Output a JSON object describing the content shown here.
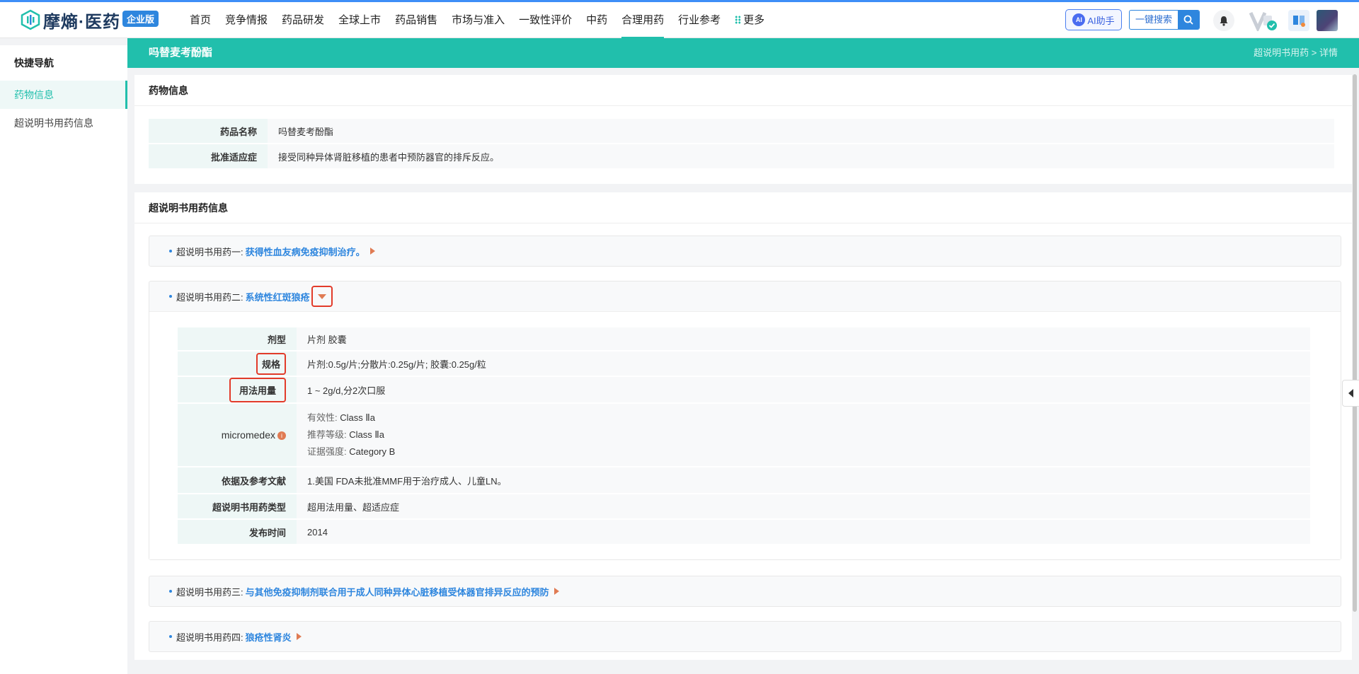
{
  "brand": {
    "name": "摩熵·医药",
    "badge": "企业版"
  },
  "nav": [
    {
      "label": "首页"
    },
    {
      "label": "竞争情报"
    },
    {
      "label": "药品研发"
    },
    {
      "label": "全球上市"
    },
    {
      "label": "药品销售"
    },
    {
      "label": "市场与准入"
    },
    {
      "label": "一致性评价"
    },
    {
      "label": "中药"
    },
    {
      "label": "合理用药",
      "active": true
    },
    {
      "label": "行业参考"
    },
    {
      "label": "更多"
    }
  ],
  "toolbar": {
    "ai_label": "AI助手",
    "ai_icon": "AI",
    "search_label": "一键搜索"
  },
  "sidebar": {
    "title": "快捷导航",
    "items": [
      {
        "label": "药物信息",
        "active": true
      },
      {
        "label": "超说明书用药信息"
      }
    ]
  },
  "header": {
    "title": "吗替麦考酚酯",
    "breadcrumb": "超说明书用药 > 详情"
  },
  "drug_info": {
    "title": "药物信息",
    "rows": [
      {
        "key": "药品名称",
        "value": "吗替麦考酚酯"
      },
      {
        "key": "批准适应症",
        "value": "接受同种异体肾脏移植的患者中预防器官的排斥反应。"
      }
    ]
  },
  "offlabel": {
    "title": "超说明书用药信息",
    "items": [
      {
        "label": "超说明书用药一:",
        "link": "获得性血友病免疫抑制治疗。"
      },
      {
        "label": "超说明书用药二:",
        "link": "系统性红斑狼疮"
      },
      {
        "label": "超说明书用药三:",
        "link": "与其他免疫抑制剂联合用于成人同种异体心脏移植受体器官排异反应的预防"
      },
      {
        "label": "超说明书用药四:",
        "link": "狼疮性肾炎"
      }
    ],
    "detail": {
      "dosage_form": {
        "key": "剂型",
        "value": "片剂 胶囊"
      },
      "spec": {
        "key": "规格",
        "value": "片剂:0.5g/片;分散片:0.25g/片; 胶囊:0.25g/粒"
      },
      "usage": {
        "key": "用法用量",
        "value": "1 ~ 2g/d,分2次口服"
      },
      "micromedex": {
        "key": "micromedex",
        "info_icon": "i",
        "efficacy_label": "有效性:",
        "efficacy": "Class Ⅱa",
        "recommend_label": "推荐等级:",
        "recommend": "Class Ⅱa",
        "evidence_label": "证据强度:",
        "evidence": "Category B"
      },
      "reference": {
        "key": "依据及参考文献",
        "value": "1.美国 FDA未批准MMF用于治疗成人、儿童LN。"
      },
      "type": {
        "key": "超说明书用药类型",
        "value": "超用法用量、超适应症"
      },
      "published": {
        "key": "发布时间",
        "value": "2014"
      }
    }
  },
  "colors": {
    "accent": "#21bfac",
    "link": "#2e86de",
    "highlight": "#e23b2a",
    "arrow": "#e07b53"
  }
}
